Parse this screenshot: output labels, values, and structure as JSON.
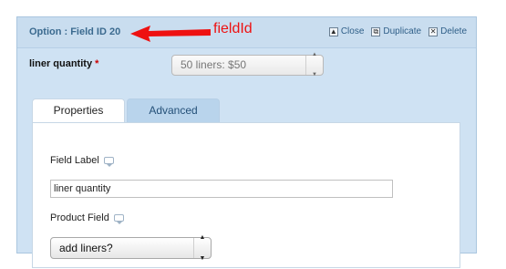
{
  "header": {
    "title": "Option : Field ID 20",
    "annotation": "fieldId",
    "actions": {
      "close": "Close",
      "duplicate": "Duplicate",
      "delete": "Delete"
    }
  },
  "field": {
    "label": "liner quantity",
    "required_marker": "*",
    "selected_option": "50 liners: $50"
  },
  "tabs": [
    {
      "label": "Properties",
      "active": true
    },
    {
      "label": "Advanced",
      "active": false
    }
  ],
  "properties": {
    "field_label_caption": "Field Label",
    "field_label_value": "liner quantity",
    "product_field_caption": "Product Field",
    "product_field_selected": "add liners?"
  },
  "colors": {
    "panel_bg": "#cfe2f3",
    "annotation_red": "#ee1111",
    "title_blue": "#3b6a8f"
  }
}
